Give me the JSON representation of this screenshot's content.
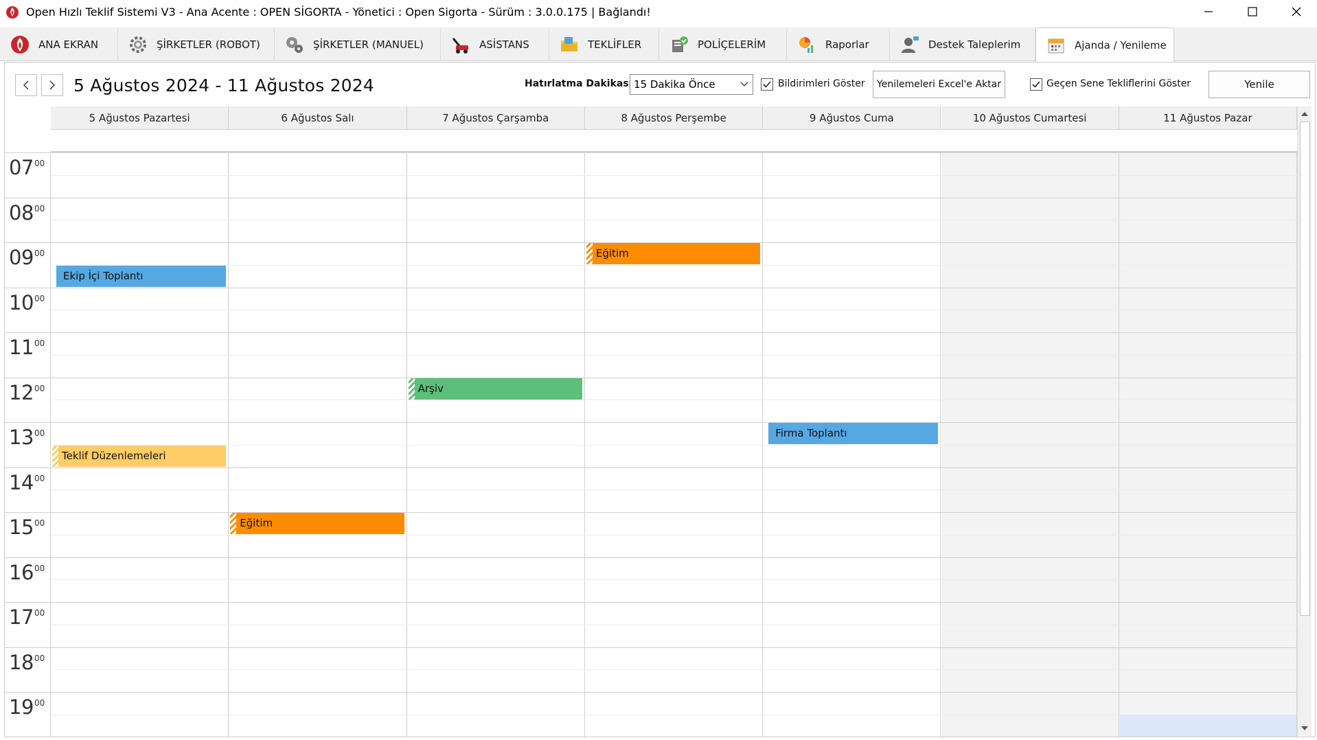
{
  "window": {
    "title": "Open Hızlı Teklif Sistemi V3 - Ana Acente : OPEN SİGORTA - Yönetici : Open Sigorta - Sürüm : 3.0.0.175 | Bağlandı!"
  },
  "tabs": [
    {
      "label": "ANA EKRAN",
      "icon": "flame-logo-icon"
    },
    {
      "label": "ŞİRKETLER (ROBOT)",
      "icon": "gear-icon"
    },
    {
      "label": "ŞİRKETLER (MANUEL)",
      "icon": "gears-icon"
    },
    {
      "label": "ASİSTANS",
      "icon": "tow-truck-icon"
    },
    {
      "label": "TEKLİFLER",
      "icon": "folder-icon"
    },
    {
      "label": "POLİÇELERİM",
      "icon": "policy-icon"
    },
    {
      "label": "Raporlar",
      "icon": "report-chart-icon"
    },
    {
      "label": "Destek Taleplerim",
      "icon": "support-agent-icon"
    },
    {
      "label": "Ajanda / Yenileme",
      "icon": "calendar-icon"
    }
  ],
  "toolbar": {
    "date_range": "5 Ağustos 2024 - 11 Ağustos 2024",
    "reminder_label": "Hatırlatma Dakikası",
    "reminder_value": "15 Dakika Önce",
    "show_notifications_label": "Bildirimleri Göster",
    "show_notifications_checked": true,
    "export_button": "Yenilemeleri Excel'e Aktar",
    "show_last_year_label": "Geçen Sene Tekliflerini Göster",
    "show_last_year_checked": true,
    "refresh_button": "Yenile"
  },
  "calendar": {
    "days": [
      {
        "label": "5 Ağustos Pazartesi",
        "weekend": false
      },
      {
        "label": "6 Ağustos Salı",
        "weekend": false
      },
      {
        "label": "7 Ağustos Çarşamba",
        "weekend": false
      },
      {
        "label": "8 Ağustos Perşembe",
        "weekend": false
      },
      {
        "label": "9 Ağustos Cuma",
        "weekend": false
      },
      {
        "label": "10 Ağustos Cumartesi",
        "weekend": true
      },
      {
        "label": "11 Ağustos Pazar",
        "weekend": true
      }
    ],
    "hours": [
      "07",
      "08",
      "09",
      "10",
      "11",
      "12",
      "13",
      "14",
      "15",
      "16",
      "17",
      "18",
      "19"
    ],
    "minutes_label": "00",
    "events": [
      {
        "title": "Ekip İçi Toplantı",
        "day": 0,
        "start": "09:30",
        "color": "#56a8e3",
        "tentative": false
      },
      {
        "title": "Eğitim",
        "day": 3,
        "start": "09:00",
        "color": "#ff8c00",
        "tentative": true
      },
      {
        "title": "Arşiv",
        "day": 2,
        "start": "12:00",
        "color": "#5cbf7a",
        "tentative": true
      },
      {
        "title": "Firma Toplantı",
        "day": 4,
        "start": "13:00",
        "color": "#56a8e3",
        "tentative": false
      },
      {
        "title": "Teklif Düzenlemeleri",
        "day": 0,
        "start": "13:30",
        "color": "#ffcc66",
        "tentative": true
      },
      {
        "title": "Eğitim",
        "day": 1,
        "start": "15:00",
        "color": "#ff8c00",
        "tentative": true
      }
    ]
  }
}
